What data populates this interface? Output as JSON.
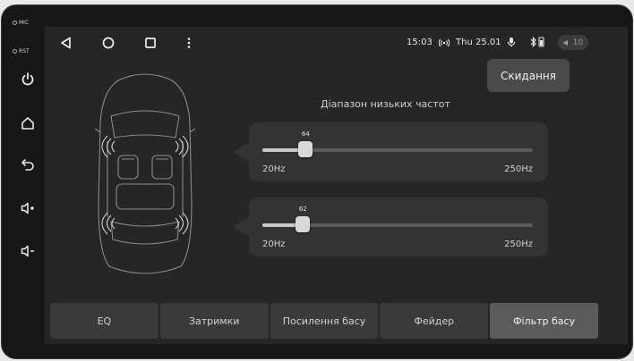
{
  "side_panel": {
    "mic_label": "MIC",
    "rst_label": "RST",
    "buttons": [
      "power-icon",
      "home-icon",
      "back-icon",
      "volume-up-icon",
      "volume-down-icon"
    ]
  },
  "status_bar": {
    "nav": [
      "back-triangle-icon",
      "home-circle-icon",
      "recents-square-icon",
      "more-vert-icon"
    ],
    "time": "15:03",
    "date": "Thu 25.01",
    "volume": "10"
  },
  "reset_label": "Скидання",
  "section_title": "Діапазон низьких частот",
  "sliders": [
    {
      "value": "64",
      "percent": 0.16,
      "min_label": "20Hz",
      "max_label": "250Hz"
    },
    {
      "value": "62",
      "percent": 0.15,
      "min_label": "20Hz",
      "max_label": "250Hz"
    }
  ],
  "tabs": [
    {
      "label": "EQ",
      "active": false
    },
    {
      "label": "Затримки",
      "active": false
    },
    {
      "label": "Посилення басу",
      "active": false
    },
    {
      "label": "Фейдер",
      "active": false
    },
    {
      "label": "Фільтр басу",
      "active": true
    }
  ],
  "colors": {
    "screen_bg": "#262626",
    "card_bg": "#333333",
    "active_tab": "#5b5b5b"
  }
}
